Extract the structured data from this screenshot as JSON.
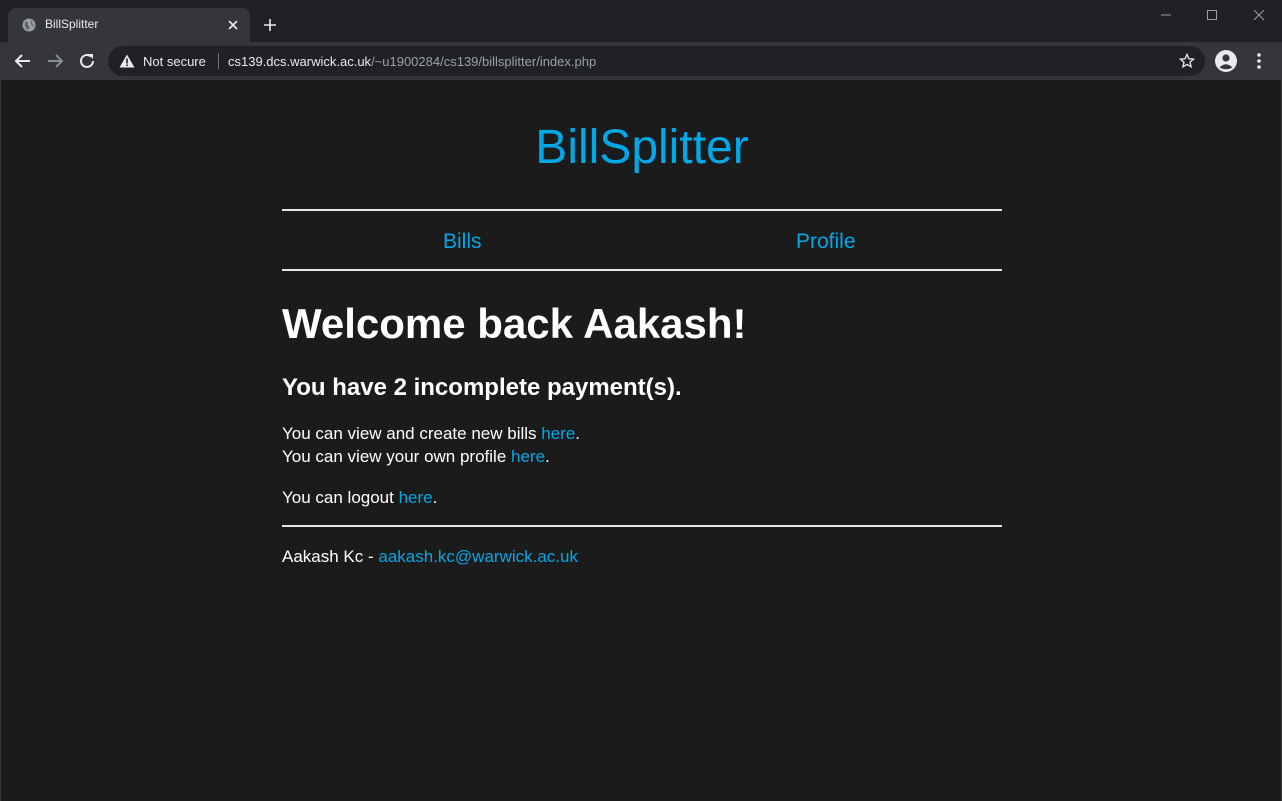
{
  "browser": {
    "tab_title": "BillSplitter",
    "security_label": "Not secure",
    "url_host": "cs139.dcs.warwick.ac.uk",
    "url_path": "/~u1900284/cs139/billsplitter/index.php",
    "icons": {
      "favicon": "globe-icon",
      "tab_close": "close-icon",
      "new_tab": "plus-icon",
      "back": "arrow-left-icon",
      "forward": "arrow-right-icon",
      "reload": "reload-icon",
      "security": "warning-icon",
      "bookmark": "star-icon",
      "profile": "account-icon",
      "menu": "kebab-menu-icon"
    }
  },
  "site": {
    "title": "BillSplitter",
    "nav": {
      "bills": "Bills",
      "profile": "Profile"
    },
    "welcome": "Welcome back Aakash!",
    "payments_notice": "You have 2 incomplete payment(s).",
    "bills_line": {
      "prefix": "You can view and create new bills ",
      "link": "here",
      "suffix": "."
    },
    "profile_line": {
      "prefix": "You can view your own profile ",
      "link": "here",
      "suffix": "."
    },
    "logout_line": {
      "prefix": "You can logout ",
      "link": "here",
      "suffix": "."
    },
    "footer": {
      "name": "Aakash Kc - ",
      "email": "aakash.kc@warwick.ac.uk"
    }
  },
  "colors": {
    "accent": "#00a8e8",
    "background": "#1b1b1b",
    "text": "#ffffff"
  }
}
